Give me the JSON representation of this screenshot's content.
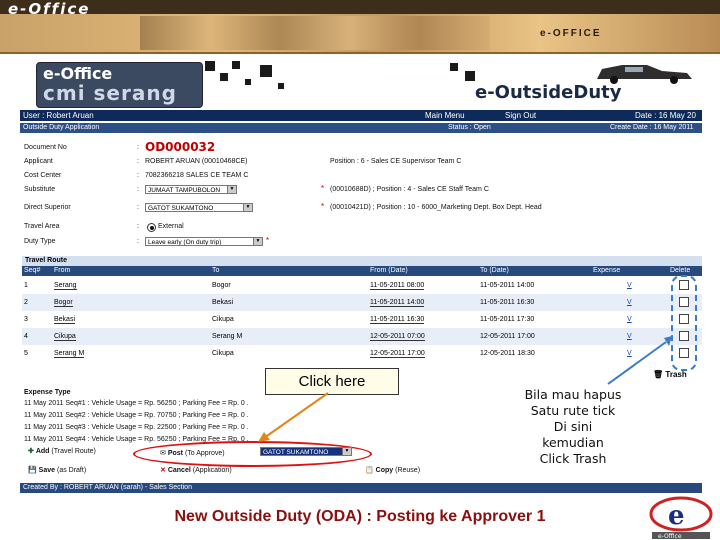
{
  "banner": {
    "logo_text": "e-Office",
    "right_title": "e-OFFICE"
  },
  "header": {
    "app_name": "e-Office",
    "app_subname": "cmi serang",
    "module_title": "e-OutsideDuty"
  },
  "nav": {
    "user": "User : Robert Aruan",
    "main_menu": "Main Menu",
    "sign_out": "Sign Out",
    "date": "Date : 16 May 20"
  },
  "status_bar": {
    "section": "Outside Duty Application",
    "status": "Status : Open",
    "create_date": "Create Date : 16 May 2011"
  },
  "form": {
    "doc_label": "Document No",
    "doc_value": "OD000032",
    "applicant_label": "Applicant",
    "applicant_value": "ROBERT ARUAN (00010468CE)",
    "applicant_pos": "Position : 6 - Sales CE Supervisor Team C",
    "cost_label": "Cost Center",
    "cost_value": "7082366218 SALES CE TEAM C",
    "substitute_label": "Substitute",
    "substitute_value": "JUMAAT TAMPUBOLON",
    "substitute_pos": "(00010688D) ; Position : 4 - Sales CE Staff Team C",
    "supervisor_label": "Direct Superior",
    "supervisor_value": "GATOT SUKAMTONO",
    "supervisor_pos": "(00010421D) ; Position : 10 - 6000_Marketing Dept. Box Dept. Head",
    "travel_area_label": "Travel Area",
    "travel_area_value": "External",
    "duty_type_label": "Duty Type",
    "duty_type_value": "Leave early (On duty trip)"
  },
  "route": {
    "title": "Travel Route",
    "headers": {
      "seq": "Seq#",
      "from": "From",
      "to": "To",
      "from_date": "From (Date)",
      "to_date": "To (Date)",
      "expense": "Expense",
      "delete": "Delete"
    },
    "rows": [
      {
        "seq": "1",
        "from": "Serang",
        "to": "Bogor",
        "from_date": "11-05-2011 08:00",
        "to_date": "11-05-2011 14:00",
        "expense": "V"
      },
      {
        "seq": "2",
        "from": "Bogor",
        "to": "Bekasi",
        "from_date": "11-05-2011 14:00",
        "to_date": "11-05-2011 16:30",
        "expense": "V"
      },
      {
        "seq": "3",
        "from": "Bekasi",
        "to": "Cikupa",
        "from_date": "11-05-2011 16:30",
        "to_date": "11-05-2011 17:30",
        "expense": "V"
      },
      {
        "seq": "4",
        "from": "Cikupa",
        "to": "Serang M",
        "from_date": "12-05-2011 07:00",
        "to_date": "12-05-2011 17:00",
        "expense": "V"
      },
      {
        "seq": "5",
        "from": "Serang M",
        "to": "Cikupa",
        "from_date": "12-05-2011 17:00",
        "to_date": "12-05-2011 18:30",
        "expense": "V"
      }
    ],
    "trash_label": "Trash"
  },
  "expense": {
    "title": "Expense Type",
    "lines": [
      "11 May 2011 Seq#1 : Vehicle Usage = Rp. 56250 ; Parking Fee = Rp. 0 .",
      "11 May 2011 Seq#2 : Vehicle Usage = Rp. 70750 ; Parking Fee = Rp. 0 .",
      "11 May 2011 Seq#3 : Vehicle Usage = Rp. 22500 ; Parking Fee = Rp. 0 .",
      "11 May 2011 Seq#4 : Vehicle Usage = Rp. 56250 ; Parking Fee = Rp. 0 ."
    ]
  },
  "actions": {
    "add": "Add",
    "add_note": "(Travel Route)",
    "post": "Post",
    "post_note": "(To Approve)",
    "approver_value": "GATOT SUKAMTONO",
    "save": "Save",
    "save_note": "(as Draft)",
    "cancel": "Cancel",
    "cancel_note": "(Application)",
    "copy": "Copy",
    "copy_note": "(Reuse)"
  },
  "footer": {
    "created_by": "Created By : ROBERT ARUAN (sarah) - Sales Section"
  },
  "annotations": {
    "click_here": "Click here",
    "trash_hint_1": "Bila mau hapus",
    "trash_hint_2": "Satu rute tick",
    "trash_hint_3": "Di sini kemudian",
    "trash_hint_4": "Click Trash",
    "slide_title": "New Outside Duty (ODA) : Posting ke Approver 1"
  },
  "colors": {
    "nav": "#0e2a5a",
    "header": "#27497e",
    "doc_number": "#c00000",
    "annotation_red": "#d11",
    "slide_title": "#8b0f0f"
  }
}
